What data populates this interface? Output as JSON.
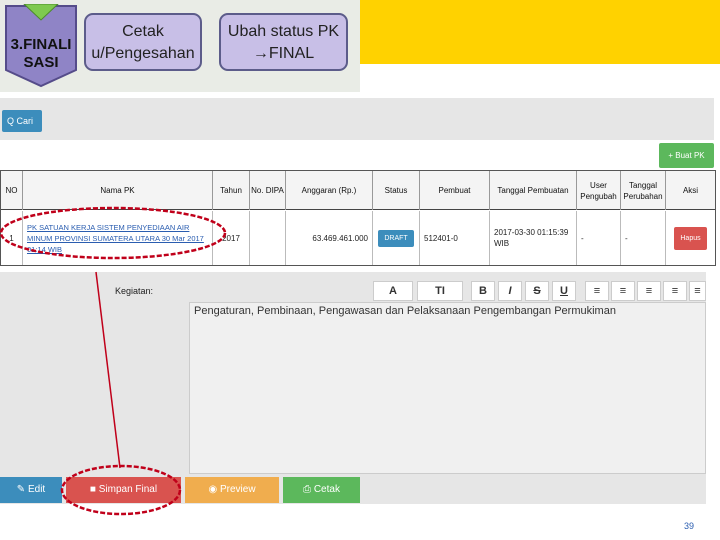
{
  "banner": {
    "step_label": "3.FINALI SASI",
    "button1": "Cetak u/Pengesahan",
    "button2": "Ubah status PK →FINAL"
  },
  "search": {
    "button_label": "Q Cari"
  },
  "add_button": "+ Buat PK",
  "table": {
    "headers": [
      "NO",
      "Nama PK",
      "Tahun",
      "No. DIPA",
      "Anggaran (Rp.)",
      "Status",
      "Pembuat",
      "Tanggal Pembuatan",
      "User Pengubah",
      "Tanggal Perubahan",
      "Aksi"
    ],
    "row": {
      "no": "1",
      "nama_pk": "PK SATUAN KERJA SISTEM PENYEDIAAN AIR MINUM PROVINSI SUMATERA UTARA 30 Mar 2017 01:14 WIB",
      "tahun": "2017",
      "no_dipa": "",
      "anggaran": "63.469.461.000",
      "status": "DRAFT",
      "pembuat": "512401-0",
      "tanggal_pembuatan": "2017-03-30 01:15:39 WIB",
      "user_pengubah": "-",
      "tanggal_perubahan": "-",
      "aksi": "Hapus"
    }
  },
  "editor": {
    "label": "Kegiatan:",
    "toolbar": [
      "A",
      "TI",
      "B",
      "I",
      "S",
      "U"
    ],
    "content": "Pengaturan, Pembinaan, Pengawasan dan Pelaksanaan Pengembangan Permukiman"
  },
  "actions": {
    "edit": "Edit",
    "simpan_final": "Simpan Final",
    "preview": "Preview",
    "cetak": "Cetak"
  },
  "page_number": "39",
  "colors": {
    "accent": "#3c8dbc",
    "danger": "#d9534f",
    "success": "#5cb85c",
    "warning": "#f0ad4e",
    "banner": "#ffd200",
    "annotation": "#c0001a"
  }
}
